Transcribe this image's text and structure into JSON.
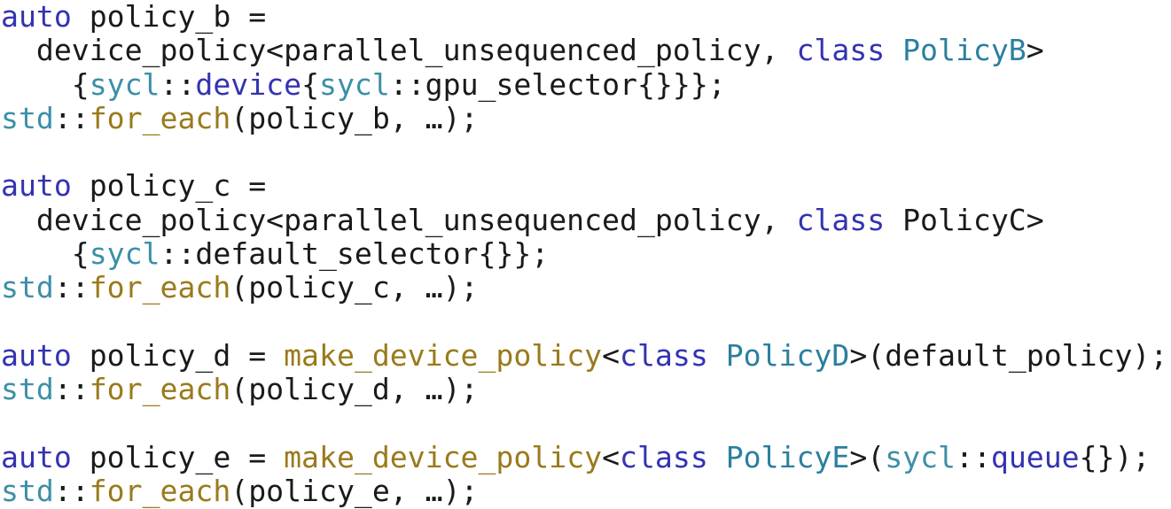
{
  "document": {
    "kind": "code-snippet",
    "language": "C++ (SYCL / oneDPL)",
    "background_color": "#ffffff",
    "font_size_px": 33,
    "line_height_px": 38
  },
  "palette": {
    "plain": "#1a1a1a",
    "keyword": "#3333b2",
    "namespace": "#3d8fa8",
    "type": "#3333b2",
    "type_identifier": "#2b7f9e",
    "function": "#9a7a1c",
    "punctuation": "#1a1a1a"
  },
  "code": {
    "lines": [
      {
        "id": "line-1",
        "text": "auto policy_b =",
        "tokens": [
          {
            "t": "auto",
            "c": "keyword"
          },
          {
            "t": " policy_b =",
            "c": "plain"
          }
        ]
      },
      {
        "id": "line-2",
        "text": "  device_policy<parallel_unsequenced_policy, class PolicyB>",
        "tokens": [
          {
            "t": "  device_policy<parallel_unsequenced_policy, ",
            "c": "plain"
          },
          {
            "t": "class",
            "c": "keyword"
          },
          {
            "t": " ",
            "c": "plain"
          },
          {
            "t": "PolicyB",
            "c": "type_identifier"
          },
          {
            "t": ">",
            "c": "plain"
          }
        ]
      },
      {
        "id": "line-3",
        "text": "    {sycl::device{sycl::gpu_selector{}}};",
        "tokens": [
          {
            "t": "    {",
            "c": "plain"
          },
          {
            "t": "sycl",
            "c": "namespace"
          },
          {
            "t": "::",
            "c": "plain"
          },
          {
            "t": "device",
            "c": "type"
          },
          {
            "t": "{",
            "c": "plain"
          },
          {
            "t": "sycl",
            "c": "namespace"
          },
          {
            "t": "::gpu_selector{}}};",
            "c": "plain"
          }
        ]
      },
      {
        "id": "line-4",
        "text": "std::for_each(policy_b, …);",
        "tokens": [
          {
            "t": "std",
            "c": "namespace"
          },
          {
            "t": "::",
            "c": "plain"
          },
          {
            "t": "for_each",
            "c": "function"
          },
          {
            "t": "(policy_b, …);",
            "c": "plain"
          }
        ]
      },
      {
        "id": "line-5",
        "text": "",
        "tokens": []
      },
      {
        "id": "line-6",
        "text": "auto policy_c =",
        "tokens": [
          {
            "t": "auto",
            "c": "keyword"
          },
          {
            "t": " policy_c =",
            "c": "plain"
          }
        ]
      },
      {
        "id": "line-7",
        "text": "  device_policy<parallel_unsequenced_policy, class PolicyC>",
        "tokens": [
          {
            "t": "  device_policy<parallel_unsequenced_policy, ",
            "c": "plain"
          },
          {
            "t": "class",
            "c": "keyword"
          },
          {
            "t": " PolicyC>",
            "c": "plain"
          }
        ]
      },
      {
        "id": "line-8",
        "text": "    {sycl::default_selector{}};",
        "tokens": [
          {
            "t": "    {",
            "c": "plain"
          },
          {
            "t": "sycl",
            "c": "namespace"
          },
          {
            "t": "::default_selector{}};",
            "c": "plain"
          }
        ]
      },
      {
        "id": "line-9",
        "text": "std::for_each(policy_c, …);",
        "tokens": [
          {
            "t": "std",
            "c": "namespace"
          },
          {
            "t": "::",
            "c": "plain"
          },
          {
            "t": "for_each",
            "c": "function"
          },
          {
            "t": "(policy_c, …);",
            "c": "plain"
          }
        ]
      },
      {
        "id": "line-10",
        "text": "",
        "tokens": []
      },
      {
        "id": "line-11",
        "text": "auto policy_d = make_device_policy<class PolicyD>(default_policy);",
        "tokens": [
          {
            "t": "auto",
            "c": "keyword"
          },
          {
            "t": " policy_d = ",
            "c": "plain"
          },
          {
            "t": "make_device_policy",
            "c": "function"
          },
          {
            "t": "<",
            "c": "plain"
          },
          {
            "t": "class",
            "c": "keyword"
          },
          {
            "t": " ",
            "c": "plain"
          },
          {
            "t": "PolicyD",
            "c": "type_identifier"
          },
          {
            "t": ">(default_policy);",
            "c": "plain"
          }
        ]
      },
      {
        "id": "line-12",
        "text": "std::for_each(policy_d, …);",
        "tokens": [
          {
            "t": "std",
            "c": "namespace"
          },
          {
            "t": "::",
            "c": "plain"
          },
          {
            "t": "for_each",
            "c": "function"
          },
          {
            "t": "(policy_d, …);",
            "c": "plain"
          }
        ]
      },
      {
        "id": "line-13",
        "text": "",
        "tokens": []
      },
      {
        "id": "line-14",
        "text": "auto policy_e = make_device_policy<class PolicyE>(sycl::queue{});",
        "tokens": [
          {
            "t": "auto",
            "c": "keyword"
          },
          {
            "t": " policy_e = ",
            "c": "plain"
          },
          {
            "t": "make_device_policy",
            "c": "function"
          },
          {
            "t": "<",
            "c": "plain"
          },
          {
            "t": "class",
            "c": "keyword"
          },
          {
            "t": " ",
            "c": "plain"
          },
          {
            "t": "PolicyE",
            "c": "type_identifier"
          },
          {
            "t": ">(",
            "c": "plain"
          },
          {
            "t": "sycl",
            "c": "namespace"
          },
          {
            "t": "::",
            "c": "plain"
          },
          {
            "t": "queue",
            "c": "type"
          },
          {
            "t": "{});",
            "c": "plain"
          }
        ]
      },
      {
        "id": "line-15",
        "text": "std::for_each(policy_e, …);",
        "tokens": [
          {
            "t": "std",
            "c": "namespace"
          },
          {
            "t": "::",
            "c": "plain"
          },
          {
            "t": "for_each",
            "c": "function"
          },
          {
            "t": "(policy_e, …);",
            "c": "plain"
          }
        ]
      }
    ]
  }
}
